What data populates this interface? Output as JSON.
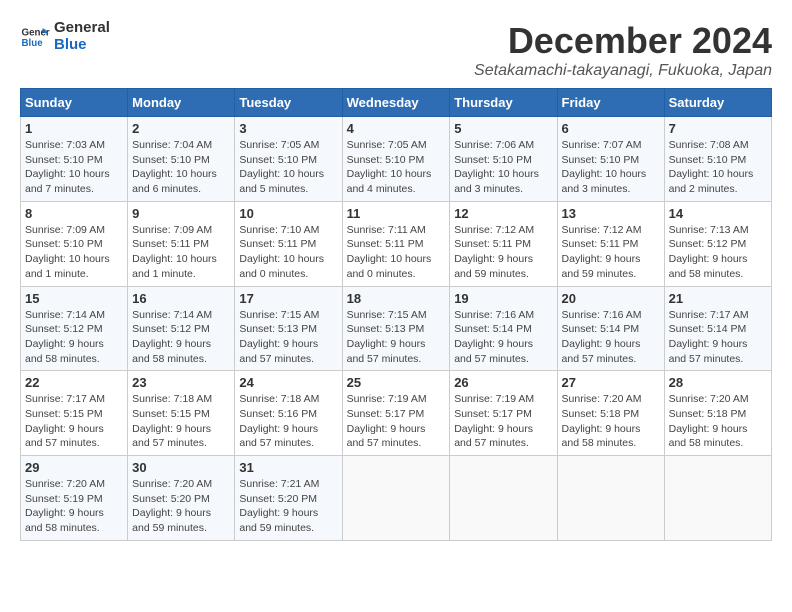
{
  "logo": {
    "line1": "General",
    "line2": "Blue"
  },
  "calendar": {
    "title": "December 2024",
    "subtitle": "Setakamachi-takayanagi, Fukuoka, Japan",
    "days_header": [
      "Sunday",
      "Monday",
      "Tuesday",
      "Wednesday",
      "Thursday",
      "Friday",
      "Saturday"
    ]
  },
  "weeks": [
    [
      {
        "day": "1",
        "info": "Sunrise: 7:03 AM\nSunset: 5:10 PM\nDaylight: 10 hours\nand 7 minutes."
      },
      {
        "day": "2",
        "info": "Sunrise: 7:04 AM\nSunset: 5:10 PM\nDaylight: 10 hours\nand 6 minutes."
      },
      {
        "day": "3",
        "info": "Sunrise: 7:05 AM\nSunset: 5:10 PM\nDaylight: 10 hours\nand 5 minutes."
      },
      {
        "day": "4",
        "info": "Sunrise: 7:05 AM\nSunset: 5:10 PM\nDaylight: 10 hours\nand 4 minutes."
      },
      {
        "day": "5",
        "info": "Sunrise: 7:06 AM\nSunset: 5:10 PM\nDaylight: 10 hours\nand 3 minutes."
      },
      {
        "day": "6",
        "info": "Sunrise: 7:07 AM\nSunset: 5:10 PM\nDaylight: 10 hours\nand 3 minutes."
      },
      {
        "day": "7",
        "info": "Sunrise: 7:08 AM\nSunset: 5:10 PM\nDaylight: 10 hours\nand 2 minutes."
      }
    ],
    [
      {
        "day": "8",
        "info": "Sunrise: 7:09 AM\nSunset: 5:10 PM\nDaylight: 10 hours\nand 1 minute."
      },
      {
        "day": "9",
        "info": "Sunrise: 7:09 AM\nSunset: 5:11 PM\nDaylight: 10 hours\nand 1 minute."
      },
      {
        "day": "10",
        "info": "Sunrise: 7:10 AM\nSunset: 5:11 PM\nDaylight: 10 hours\nand 0 minutes."
      },
      {
        "day": "11",
        "info": "Sunrise: 7:11 AM\nSunset: 5:11 PM\nDaylight: 10 hours\nand 0 minutes."
      },
      {
        "day": "12",
        "info": "Sunrise: 7:12 AM\nSunset: 5:11 PM\nDaylight: 9 hours\nand 59 minutes."
      },
      {
        "day": "13",
        "info": "Sunrise: 7:12 AM\nSunset: 5:11 PM\nDaylight: 9 hours\nand 59 minutes."
      },
      {
        "day": "14",
        "info": "Sunrise: 7:13 AM\nSunset: 5:12 PM\nDaylight: 9 hours\nand 58 minutes."
      }
    ],
    [
      {
        "day": "15",
        "info": "Sunrise: 7:14 AM\nSunset: 5:12 PM\nDaylight: 9 hours\nand 58 minutes."
      },
      {
        "day": "16",
        "info": "Sunrise: 7:14 AM\nSunset: 5:12 PM\nDaylight: 9 hours\nand 58 minutes."
      },
      {
        "day": "17",
        "info": "Sunrise: 7:15 AM\nSunset: 5:13 PM\nDaylight: 9 hours\nand 57 minutes."
      },
      {
        "day": "18",
        "info": "Sunrise: 7:15 AM\nSunset: 5:13 PM\nDaylight: 9 hours\nand 57 minutes."
      },
      {
        "day": "19",
        "info": "Sunrise: 7:16 AM\nSunset: 5:14 PM\nDaylight: 9 hours\nand 57 minutes."
      },
      {
        "day": "20",
        "info": "Sunrise: 7:16 AM\nSunset: 5:14 PM\nDaylight: 9 hours\nand 57 minutes."
      },
      {
        "day": "21",
        "info": "Sunrise: 7:17 AM\nSunset: 5:14 PM\nDaylight: 9 hours\nand 57 minutes."
      }
    ],
    [
      {
        "day": "22",
        "info": "Sunrise: 7:17 AM\nSunset: 5:15 PM\nDaylight: 9 hours\nand 57 minutes."
      },
      {
        "day": "23",
        "info": "Sunrise: 7:18 AM\nSunset: 5:15 PM\nDaylight: 9 hours\nand 57 minutes."
      },
      {
        "day": "24",
        "info": "Sunrise: 7:18 AM\nSunset: 5:16 PM\nDaylight: 9 hours\nand 57 minutes."
      },
      {
        "day": "25",
        "info": "Sunrise: 7:19 AM\nSunset: 5:17 PM\nDaylight: 9 hours\nand 57 minutes."
      },
      {
        "day": "26",
        "info": "Sunrise: 7:19 AM\nSunset: 5:17 PM\nDaylight: 9 hours\nand 57 minutes."
      },
      {
        "day": "27",
        "info": "Sunrise: 7:20 AM\nSunset: 5:18 PM\nDaylight: 9 hours\nand 58 minutes."
      },
      {
        "day": "28",
        "info": "Sunrise: 7:20 AM\nSunset: 5:18 PM\nDaylight: 9 hours\nand 58 minutes."
      }
    ],
    [
      {
        "day": "29",
        "info": "Sunrise: 7:20 AM\nSunset: 5:19 PM\nDaylight: 9 hours\nand 58 minutes."
      },
      {
        "day": "30",
        "info": "Sunrise: 7:20 AM\nSunset: 5:20 PM\nDaylight: 9 hours\nand 59 minutes."
      },
      {
        "day": "31",
        "info": "Sunrise: 7:21 AM\nSunset: 5:20 PM\nDaylight: 9 hours\nand 59 minutes."
      },
      {
        "day": "",
        "info": ""
      },
      {
        "day": "",
        "info": ""
      },
      {
        "day": "",
        "info": ""
      },
      {
        "day": "",
        "info": ""
      }
    ]
  ]
}
